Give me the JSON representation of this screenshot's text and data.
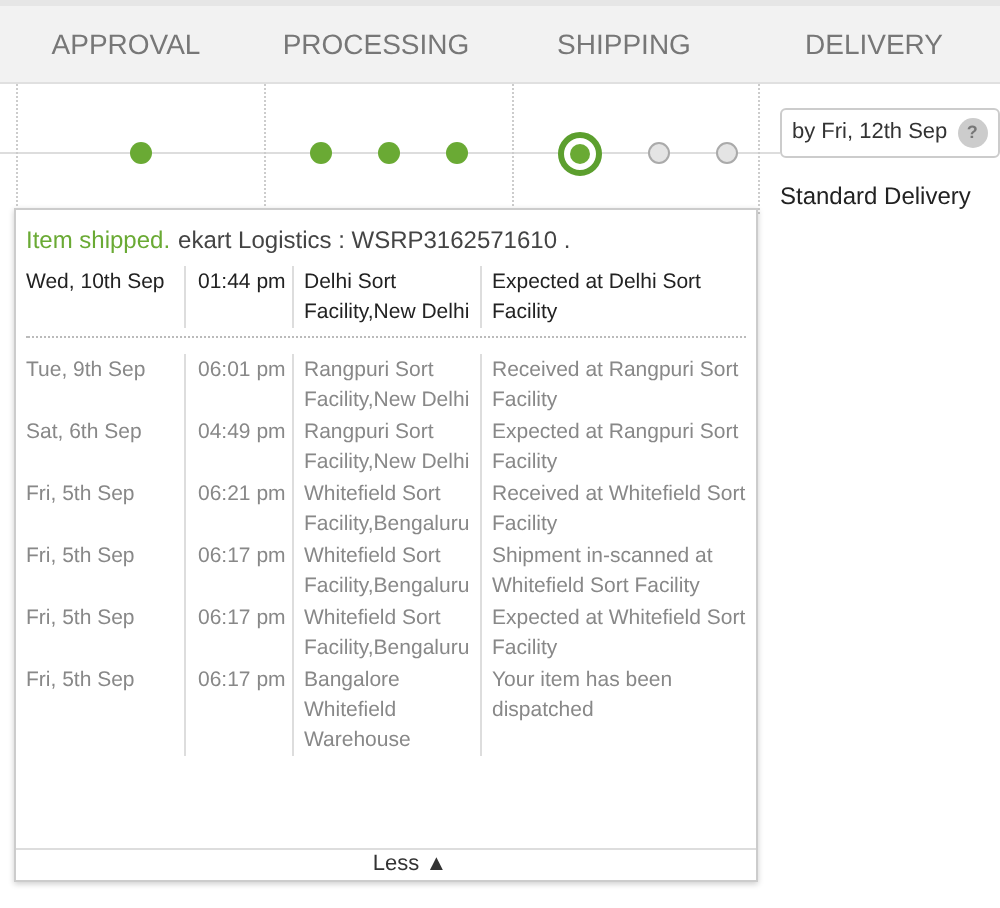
{
  "stages": [
    {
      "label": "APPROVAL",
      "dots": [
        {
          "done": true,
          "current": false
        }
      ]
    },
    {
      "label": "PROCESSING",
      "dots": [
        {
          "done": true,
          "current": false
        },
        {
          "done": true,
          "current": false
        },
        {
          "done": true,
          "current": false
        }
      ]
    },
    {
      "label": "SHIPPING",
      "dots": [
        {
          "done": true,
          "current": true
        },
        {
          "done": false,
          "current": false
        },
        {
          "done": false,
          "current": false
        }
      ]
    },
    {
      "label": "DELIVERY"
    }
  ],
  "delivery": {
    "date": "by Fri, 12th Sep",
    "help": "?",
    "type": "Standard Delivery"
  },
  "tracking": {
    "status": "Item shipped.",
    "carrier": "ekart Logistics : WSRP3162571610 .",
    "rows": [
      {
        "date": "Wed, 10th Sep",
        "time": "01:44 pm",
        "location": "Delhi Sort Facility,New Delhi",
        "event": "Expected at Delhi Sort Facility",
        "latest": true
      },
      {
        "date": "Tue, 9th Sep",
        "time": "06:01 pm",
        "location": "Rangpuri Sort Facility,New Delhi",
        "event": "Received at Rangpuri Sort Facility",
        "latest": false
      },
      {
        "date": "Sat, 6th Sep",
        "time": "04:49 pm",
        "location": "Rangpuri Sort Facility,New Delhi",
        "event": "Expected at Rangpuri Sort Facility",
        "latest": false
      },
      {
        "date": "Fri, 5th Sep",
        "time": "06:21 pm",
        "location": "Whitefield Sort Facility,Bengaluru",
        "event": "Received at Whitefield Sort Facility",
        "latest": false
      },
      {
        "date": "Fri, 5th Sep",
        "time": "06:17 pm",
        "location": "Whitefield Sort Facility,Bengaluru",
        "event": "Shipment in-scanned at Whitefield Sort Facility",
        "latest": false
      },
      {
        "date": "Fri, 5th Sep",
        "time": "06:17 pm",
        "location": "Whitefield Sort Facility,Bengaluru",
        "event": "Expected at Whitefield Sort Facility",
        "latest": false
      },
      {
        "date": "Fri, 5th Sep",
        "time": "06:17 pm",
        "location": "Bangalore Whitefield Warehouse",
        "event": "Your item has been dispatched",
        "latest": false
      }
    ],
    "toggle": "Less ▲"
  }
}
